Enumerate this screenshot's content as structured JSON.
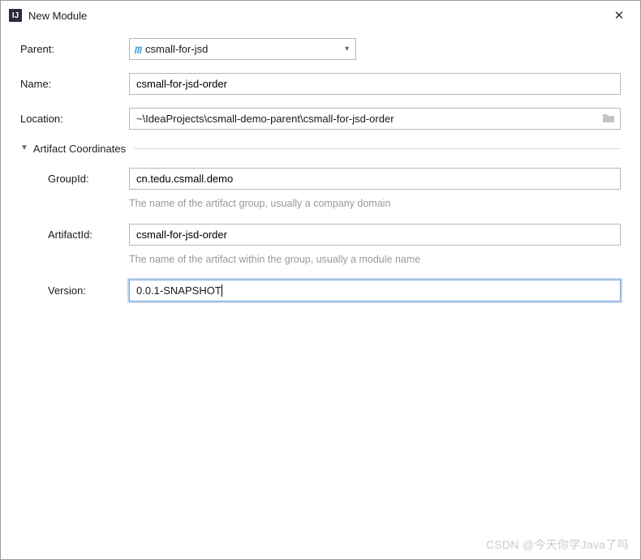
{
  "window": {
    "title": "New Module",
    "close": "✕"
  },
  "labels": {
    "parent": "Parent:",
    "name": "Name:",
    "location": "Location:",
    "groupId": "GroupId:",
    "artifactId": "ArtifactId:",
    "version": "Version:"
  },
  "parent": {
    "icon": "m",
    "value": "csmall-for-jsd"
  },
  "name": {
    "value": "csmall-for-jsd-order"
  },
  "location": {
    "value": "~\\IdeaProjects\\csmall-demo-parent\\csmall-for-jsd-order"
  },
  "section": {
    "title": "Artifact Coordinates"
  },
  "groupId": {
    "value": "cn.tedu.csmall.demo",
    "desc": "The name of the artifact group, usually a company domain"
  },
  "artifactId": {
    "value": "csmall-for-jsd-order",
    "desc": "The name of the artifact within the group, usually a module name"
  },
  "version": {
    "value": "0.0.1-SNAPSHOT"
  },
  "watermark": "CSDN @今天你学Java了吗"
}
